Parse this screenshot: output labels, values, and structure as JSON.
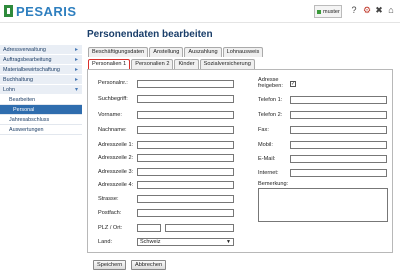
{
  "header": {
    "logo_text": "PESARIS",
    "user_label": "muster",
    "icons": [
      "help-icon",
      "settings-icon",
      "tools-icon",
      "home-icon"
    ]
  },
  "sidebar": {
    "items": [
      {
        "label": "Adressverwaltung"
      },
      {
        "label": "Auftragsbearbeitung"
      },
      {
        "label": "Materialbewirtschaftung"
      },
      {
        "label": "Buchhaltung"
      },
      {
        "label": "Lohn"
      }
    ],
    "subitems": [
      {
        "label": "Bearbeiten"
      },
      {
        "label": "Personal"
      },
      {
        "label": "Jahresabschluss"
      },
      {
        "label": "Auswertungen"
      }
    ]
  },
  "page": {
    "title": "Personendaten bearbeiten"
  },
  "tabs_row1": [
    "Beschäftigungsdaten",
    "Anstellung",
    "Auszahlung",
    "Lohnausweis"
  ],
  "tabs_row2": [
    "Personalien 1",
    "Personalien 2",
    "Kinder",
    "Sozialversicherung"
  ],
  "form_left": {
    "personalnr": "Personalnr.:",
    "suchbegriff": "Suchbegriff:",
    "vorname": "Vorname:",
    "nachname": "Nachname:",
    "adresszeile1": "Adresszeile 1:",
    "adresszeile2": "Adresszeile 2:",
    "adresszeile3": "Adresszeile 3:",
    "adresszeile4": "Adresszeile 4:",
    "strasse": "Strasse:",
    "postfach": "Postfach:",
    "plz_ort": "PLZ / Ort:",
    "land": "Land:",
    "land_value": "Schweiz"
  },
  "form_right": {
    "adresse_freigeben_1": "Adresse",
    "adresse_freigeben_2": "freigeben:",
    "checkbox_mark": "✓",
    "telefon1": "Telefon 1:",
    "telefon2": "Telefon 2:",
    "fax": "Fax:",
    "mobil": "Mobil:",
    "email": "E-Mail:",
    "internet": "Internet:",
    "bemerkung": "Bemerkung:"
  },
  "buttons": {
    "save": "Speichern",
    "cancel": "Abbrechen"
  }
}
